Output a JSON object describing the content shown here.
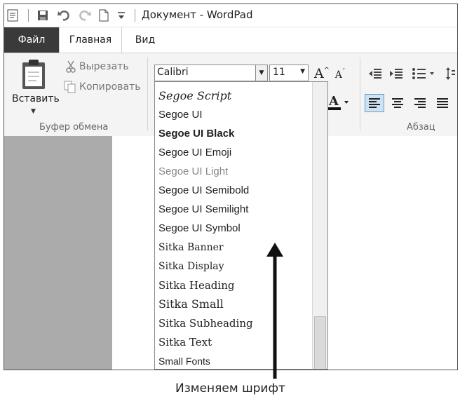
{
  "window": {
    "title": "Документ - WordPad"
  },
  "tabs": {
    "file": "Файл",
    "home": "Главная",
    "view": "Вид"
  },
  "clipboard": {
    "paste": "Вставить",
    "cut": "Вырезать",
    "copy": "Копировать",
    "group_label": "Буфер обмена"
  },
  "font": {
    "current_family": "Calibri",
    "current_size": "11"
  },
  "paragraph": {
    "group_label": "Абзац"
  },
  "font_list": [
    {
      "name": "Segoe Script",
      "css": "italic 16px \"DejaVu Serif\", serif"
    },
    {
      "name": "Segoe UI",
      "css": "15px \"Liberation Sans\", sans-serif"
    },
    {
      "name": "Segoe UI Black",
      "css": "bold 15px \"Liberation Sans\", sans-serif"
    },
    {
      "name": "Segoe UI Emoji",
      "css": "15px \"Liberation Sans\", sans-serif"
    },
    {
      "name": "Segoe UI Light",
      "css": "15px \"Liberation Sans\", sans-serif; color:#888"
    },
    {
      "name": "Segoe UI Semibold",
      "css": "15px \"Liberation Sans\", sans-serif"
    },
    {
      "name": "Segoe UI Semilight",
      "css": "15px \"Liberation Sans\", sans-serif"
    },
    {
      "name": "Segoe UI Symbol",
      "css": "15px \"Liberation Sans\", sans-serif"
    },
    {
      "name": "Sitka Banner",
      "css": "14px \"DejaVu Serif\", serif"
    },
    {
      "name": "Sitka Display",
      "css": "14px \"DejaVu Serif\", serif"
    },
    {
      "name": "Sitka Heading",
      "css": "15px \"DejaVu Serif\", serif"
    },
    {
      "name": "Sitka Small",
      "css": "16px \"DejaVu Serif\", serif"
    },
    {
      "name": "Sitka Subheading",
      "css": "15px \"DejaVu Serif\", serif"
    },
    {
      "name": "Sitka Text",
      "css": "15px \"DejaVu Serif\", serif"
    },
    {
      "name": "Small Fonts",
      "css": "14px \"Liberation Sans\", sans-serif"
    }
  ],
  "caption": "Изменяем шрифт"
}
